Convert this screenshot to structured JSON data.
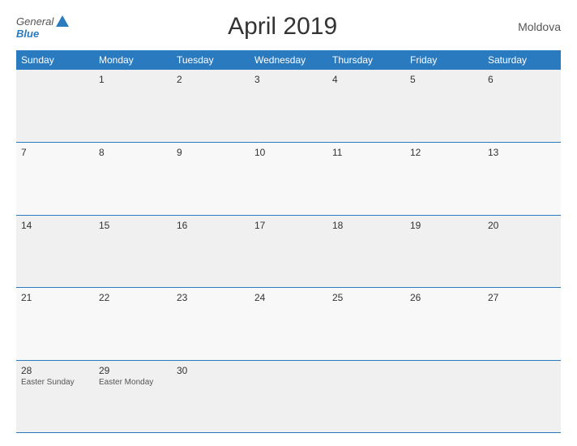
{
  "header": {
    "logo_general": "General",
    "logo_blue": "Blue",
    "title": "April 2019",
    "country": "Moldova"
  },
  "days": [
    "Sunday",
    "Monday",
    "Tuesday",
    "Wednesday",
    "Thursday",
    "Friday",
    "Saturday"
  ],
  "weeks": [
    [
      {
        "date": "",
        "event": ""
      },
      {
        "date": "1",
        "event": ""
      },
      {
        "date": "2",
        "event": ""
      },
      {
        "date": "3",
        "event": ""
      },
      {
        "date": "4",
        "event": ""
      },
      {
        "date": "5",
        "event": ""
      },
      {
        "date": "6",
        "event": ""
      }
    ],
    [
      {
        "date": "7",
        "event": ""
      },
      {
        "date": "8",
        "event": ""
      },
      {
        "date": "9",
        "event": ""
      },
      {
        "date": "10",
        "event": ""
      },
      {
        "date": "11",
        "event": ""
      },
      {
        "date": "12",
        "event": ""
      },
      {
        "date": "13",
        "event": ""
      }
    ],
    [
      {
        "date": "14",
        "event": ""
      },
      {
        "date": "15",
        "event": ""
      },
      {
        "date": "16",
        "event": ""
      },
      {
        "date": "17",
        "event": ""
      },
      {
        "date": "18",
        "event": ""
      },
      {
        "date": "19",
        "event": ""
      },
      {
        "date": "20",
        "event": ""
      }
    ],
    [
      {
        "date": "21",
        "event": ""
      },
      {
        "date": "22",
        "event": ""
      },
      {
        "date": "23",
        "event": ""
      },
      {
        "date": "24",
        "event": ""
      },
      {
        "date": "25",
        "event": ""
      },
      {
        "date": "26",
        "event": ""
      },
      {
        "date": "27",
        "event": ""
      }
    ],
    [
      {
        "date": "28",
        "event": "Easter Sunday"
      },
      {
        "date": "29",
        "event": "Easter Monday"
      },
      {
        "date": "30",
        "event": ""
      },
      {
        "date": "",
        "event": ""
      },
      {
        "date": "",
        "event": ""
      },
      {
        "date": "",
        "event": ""
      },
      {
        "date": "",
        "event": ""
      }
    ]
  ]
}
